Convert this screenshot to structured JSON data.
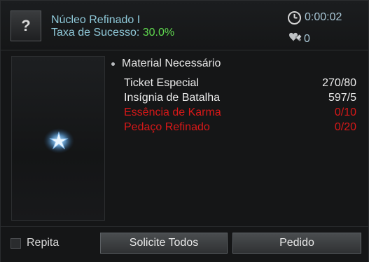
{
  "header": {
    "item_icon": "question-mark-icon",
    "item_symbol": "?",
    "item_name": "Núcleo Refinado I",
    "success_label": "Taxa de Sucesso: ",
    "success_value": "30.0%",
    "timer_icon": "clock-icon",
    "timer": "0:00:02",
    "count_icon": "hammer-heart-icon",
    "count": "0"
  },
  "preview": {
    "emblem_icon": "star-emblem-icon"
  },
  "materials": {
    "heading": "Material Necessário",
    "items": [
      {
        "name": "Ticket Especial",
        "amount": "270/80",
        "status": "ok"
      },
      {
        "name": "Insígnia de Batalha",
        "amount": "597/5",
        "status": "ok"
      },
      {
        "name": "Essência de Karma",
        "amount": "0/10",
        "status": "missing"
      },
      {
        "name": "Pedaço Refinado",
        "amount": "0/20",
        "status": "missing"
      }
    ]
  },
  "footer": {
    "repeat_label": "Repita",
    "request_all_label": "Solicite Todos",
    "order_label": "Pedido"
  },
  "colors": {
    "name_text": "#8fc9d9",
    "success_value": "#5fd84f",
    "missing_text": "#d81818"
  }
}
